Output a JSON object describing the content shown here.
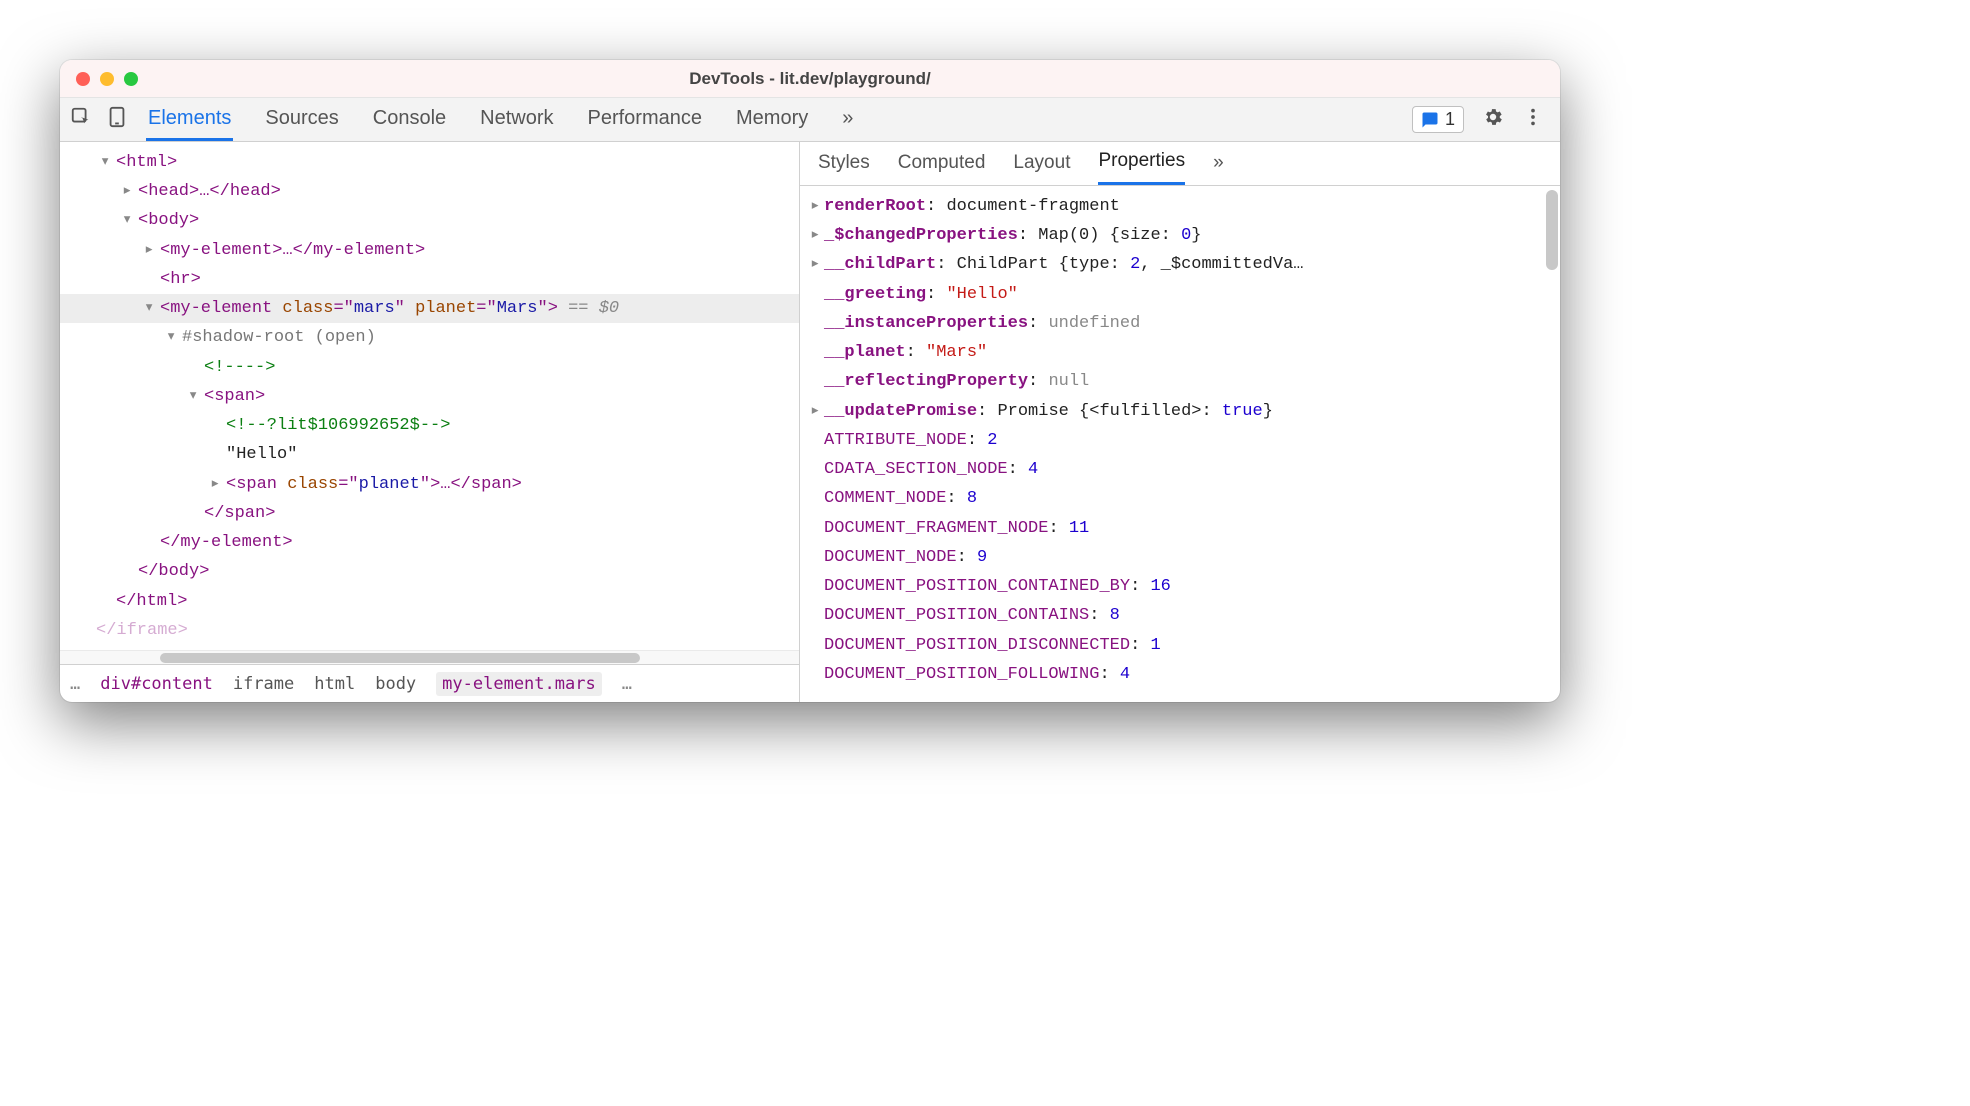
{
  "window": {
    "title": "DevTools - lit.dev/playground/"
  },
  "issues": {
    "count": "1"
  },
  "main_tabs": [
    "Elements",
    "Sources",
    "Console",
    "Network",
    "Performance",
    "Memory"
  ],
  "main_tabs_more": "»",
  "main_active_tab": 0,
  "side_tabs": [
    "Styles",
    "Computed",
    "Layout",
    "Properties"
  ],
  "side_tabs_more": "»",
  "side_active_tab": 3,
  "dom": {
    "html_open": "<html>",
    "head": "<head>…</head>",
    "body_open": "<body>",
    "myel1": "<my-element>…</my-element>",
    "hr": "<hr>",
    "myel2_open_tag": "<my-element",
    "myel2_attr_class_name": "class",
    "myel2_attr_class_val": "mars",
    "myel2_attr_planet_name": "planet",
    "myel2_attr_planet_val": "Mars",
    "myel2_close_gt": ">",
    "selection_suffix": " == $0",
    "shadow": "#shadow-root (open)",
    "comment1": "<!---->",
    "span_open": "<span>",
    "comment2": "<!--?lit$106992652$-->",
    "hello_text": "\"Hello\"",
    "span_planet": "<span class=\"planet\">…</span>",
    "span_close": "</span>",
    "myel2_close": "</my-element>",
    "body_close": "</body>",
    "html_close": "</html>",
    "iframe_close_partial": "</iframe>"
  },
  "breadcrumb": {
    "prefix": "…",
    "items": [
      "div#content",
      "iframe",
      "html",
      "body",
      "my-element.mars"
    ],
    "suffix": "…"
  },
  "properties": [
    {
      "caret": true,
      "name": "renderRoot",
      "bold": true,
      "value": "document-fragment",
      "vtype": "obj"
    },
    {
      "caret": true,
      "name": "_$changedProperties",
      "bold": true,
      "value_prefix": "Map(0) {size: ",
      "value_num": "0",
      "value_suffix": "}"
    },
    {
      "caret": true,
      "name": "__childPart",
      "bold": true,
      "value_prefix": "ChildPart {type: ",
      "value_num": "2",
      "value_mid": ", _$committedVa…"
    },
    {
      "caret": false,
      "name": "__greeting",
      "bold": true,
      "value": "\"Hello\"",
      "vtype": "str"
    },
    {
      "caret": false,
      "name": "__instanceProperties",
      "bold": true,
      "value": "undefined",
      "vtype": "undef"
    },
    {
      "caret": false,
      "name": "__planet",
      "bold": true,
      "value": "\"Mars\"",
      "vtype": "str"
    },
    {
      "caret": false,
      "name": "__reflectingProperty",
      "bold": true,
      "value": "null",
      "vtype": "undef"
    },
    {
      "caret": true,
      "name": "__updatePromise",
      "bold": true,
      "value_prefix": "Promise {<fulfilled>: ",
      "value_bool": "true",
      "value_suffix": "}"
    },
    {
      "caret": false,
      "name": "ATTRIBUTE_NODE",
      "value": "2",
      "vtype": "num"
    },
    {
      "caret": false,
      "name": "CDATA_SECTION_NODE",
      "value": "4",
      "vtype": "num"
    },
    {
      "caret": false,
      "name": "COMMENT_NODE",
      "value": "8",
      "vtype": "num"
    },
    {
      "caret": false,
      "name": "DOCUMENT_FRAGMENT_NODE",
      "value": "11",
      "vtype": "num"
    },
    {
      "caret": false,
      "name": "DOCUMENT_NODE",
      "value": "9",
      "vtype": "num"
    },
    {
      "caret": false,
      "name": "DOCUMENT_POSITION_CONTAINED_BY",
      "value": "16",
      "vtype": "num"
    },
    {
      "caret": false,
      "name": "DOCUMENT_POSITION_CONTAINS",
      "value": "8",
      "vtype": "num"
    },
    {
      "caret": false,
      "name": "DOCUMENT_POSITION_DISCONNECTED",
      "value": "1",
      "vtype": "num"
    },
    {
      "caret": false,
      "name": "DOCUMENT_POSITION_FOLLOWING",
      "value": "4",
      "vtype": "num"
    }
  ]
}
